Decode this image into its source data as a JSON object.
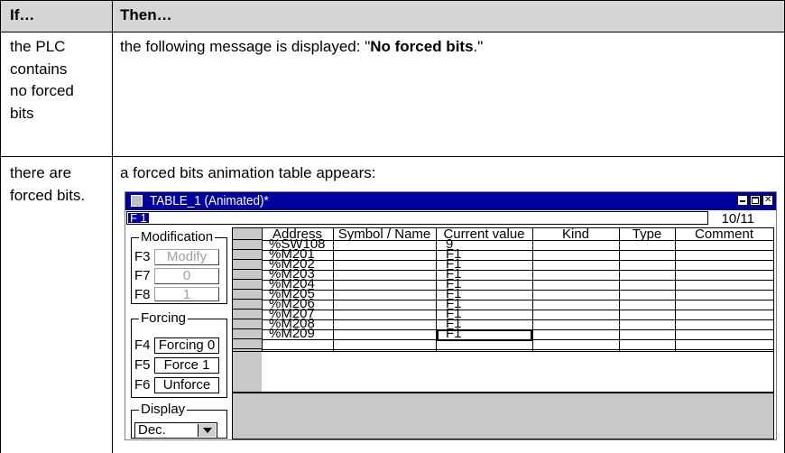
{
  "doc_table": {
    "header": {
      "if": "If…",
      "then": "Then…"
    },
    "rows": [
      {
        "if_lines": [
          "the PLC",
          "contains",
          "no forced",
          "bits"
        ],
        "then_prefix": "the following message is displayed: \"",
        "then_bold": "No forced bits",
        "then_suffix": ".\""
      },
      {
        "if_lines": [
          "there are",
          "forced bits."
        ],
        "then_text": "a forced bits animation table appears:"
      }
    ]
  },
  "window": {
    "title": "TABLE_1 (Animated)*",
    "command_value": "F 1",
    "counter": "10/11",
    "modification": {
      "label": "Modification",
      "keys": [
        {
          "key": "F3",
          "label": "Modify",
          "enabled": false
        },
        {
          "key": "F7",
          "label": "0",
          "enabled": false
        },
        {
          "key": "F8",
          "label": "1",
          "enabled": false
        }
      ]
    },
    "forcing": {
      "label": "Forcing",
      "keys": [
        {
          "key": "F4",
          "label": "Forcing 0",
          "enabled": true
        },
        {
          "key": "F5",
          "label": "Force 1",
          "enabled": true
        },
        {
          "key": "F6",
          "label": "Unforce",
          "enabled": true
        }
      ]
    },
    "display": {
      "label": "Display",
      "selected": "Dec."
    },
    "columns": [
      "Address",
      "Symbol / Name",
      "Current value",
      "Kind",
      "Type",
      "Comment"
    ],
    "rows": [
      {
        "address": "%SW108",
        "value": "9"
      },
      {
        "address": "%M201",
        "value": "F1"
      },
      {
        "address": "%M202",
        "value": "F1"
      },
      {
        "address": "%M203",
        "value": "F1"
      },
      {
        "address": "%M204",
        "value": "F1"
      },
      {
        "address": "%M205",
        "value": "F1"
      },
      {
        "address": "%M206",
        "value": "F1"
      },
      {
        "address": "%M207",
        "value": "F1"
      },
      {
        "address": "%M208",
        "value": "F1"
      },
      {
        "address": "%M209",
        "value": "F1"
      }
    ]
  },
  "colors": {
    "titlebar": "#0000a0",
    "header_bg": "#d6d6d6",
    "panel_gray": "#c8c8c8"
  }
}
